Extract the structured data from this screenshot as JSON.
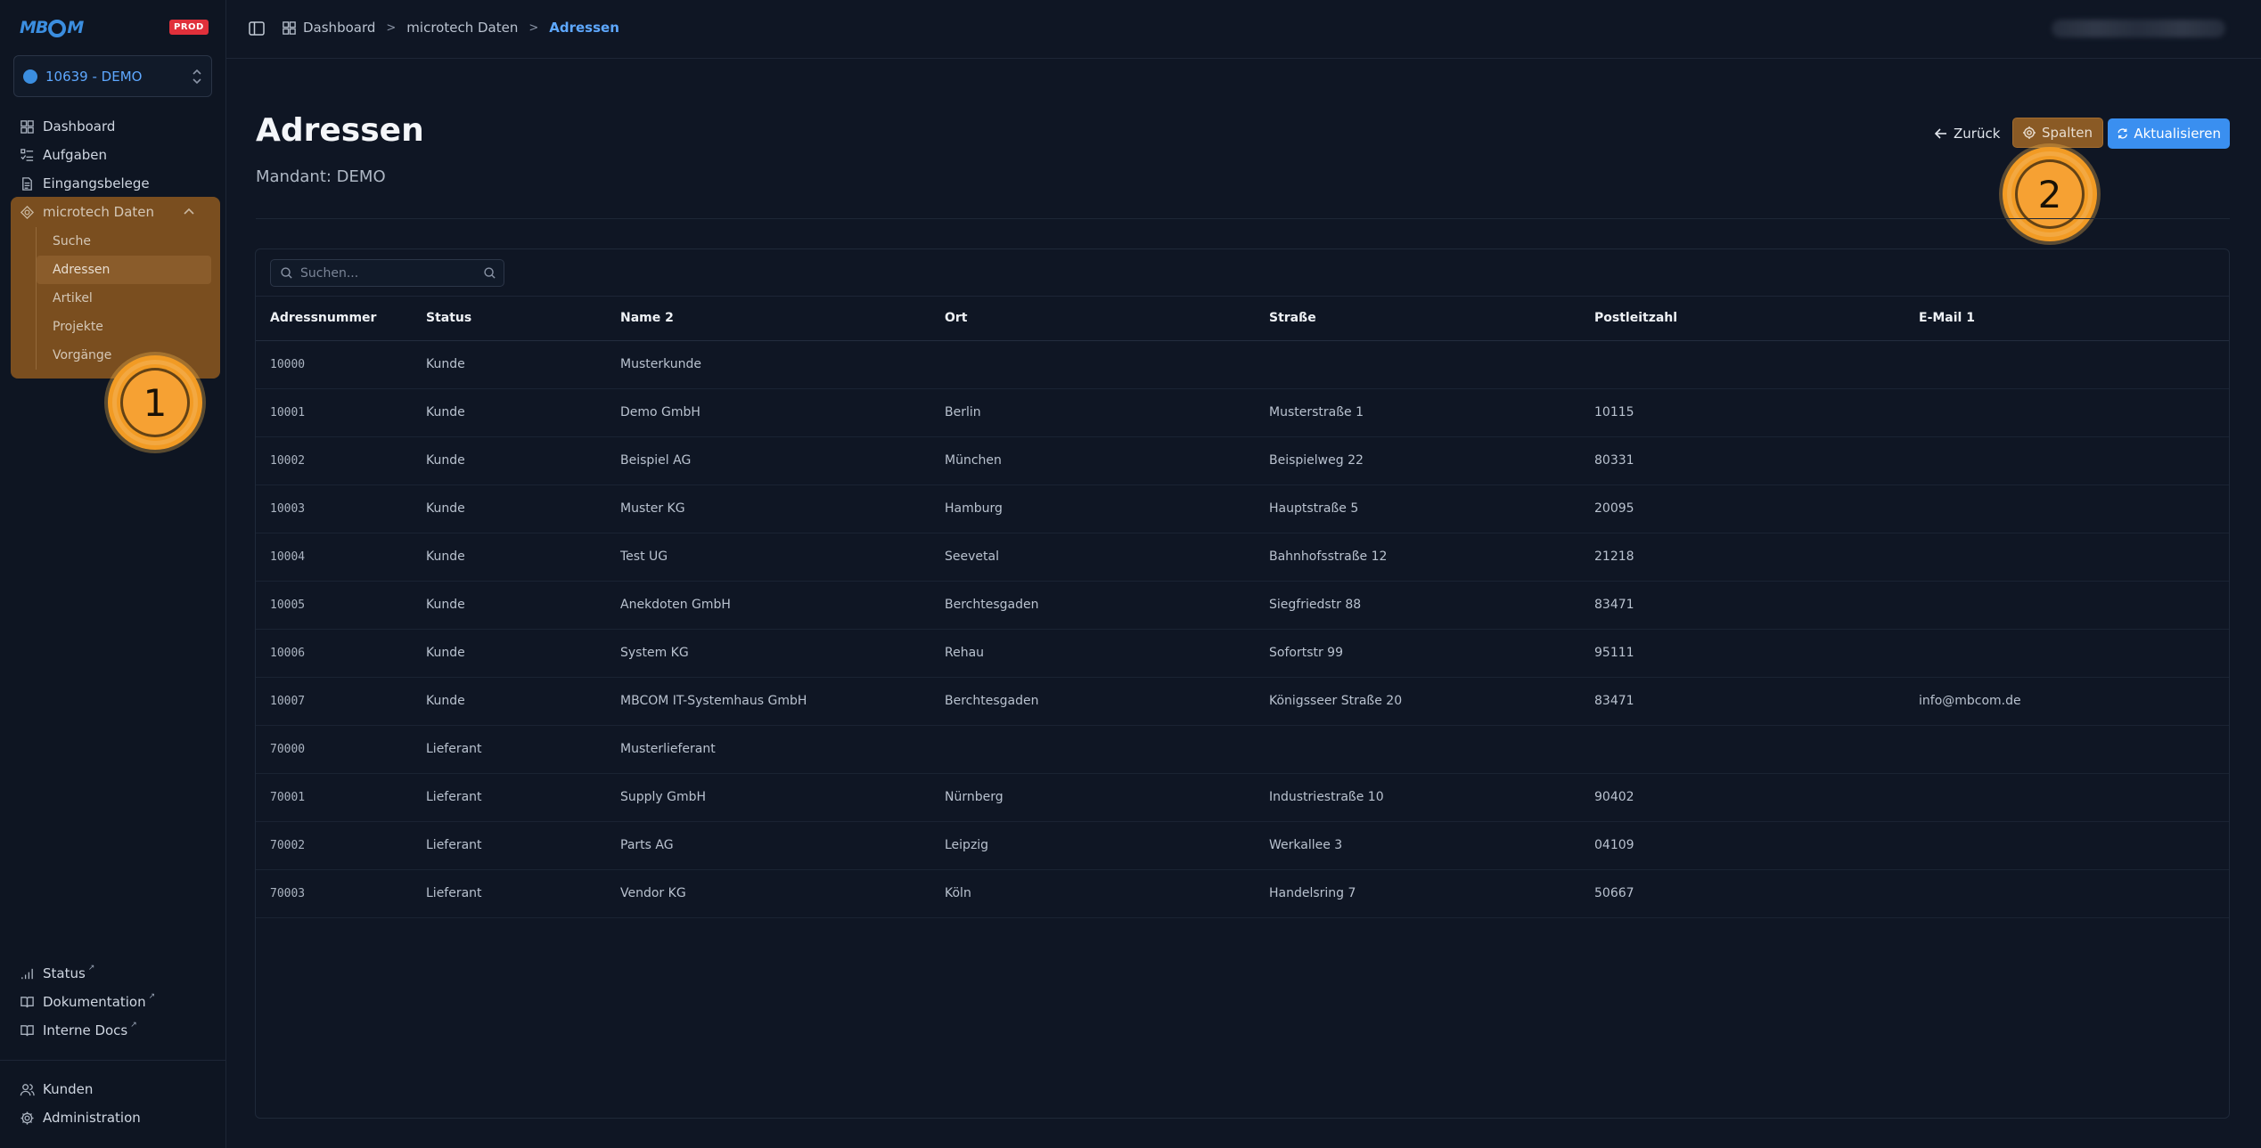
{
  "brand": {
    "logo_text_left": "MB",
    "logo_text_right": "M",
    "env_badge": "PROD"
  },
  "tenant": {
    "label": "10639 - DEMO"
  },
  "sidebar": {
    "items": [
      {
        "label": "Dashboard",
        "icon": "dashboard-icon"
      },
      {
        "label": "Aufgaben",
        "icon": "tasks-icon"
      },
      {
        "label": "Eingangsbelege",
        "icon": "document-icon"
      }
    ],
    "group": {
      "label": "microtech Daten",
      "icon": "database-icon",
      "children": [
        "Suche",
        "Adressen",
        "Artikel",
        "Projekte",
        "Vorgänge"
      ],
      "active_child": "Adressen"
    },
    "links": [
      {
        "label": "Status",
        "icon": "signal-icon"
      },
      {
        "label": "Dokumentation",
        "icon": "book-icon"
      },
      {
        "label": "Interne Docs",
        "icon": "book-icon"
      }
    ],
    "bottom": [
      {
        "label": "Kunden",
        "icon": "users-icon"
      },
      {
        "label": "Administration",
        "icon": "gear-icon"
      }
    ]
  },
  "breadcrumb": [
    "Dashboard",
    "microtech Daten",
    "Adressen"
  ],
  "page": {
    "title": "Adressen",
    "subtitle": "Mandant: DEMO"
  },
  "actions": {
    "back": "Zurück",
    "columns": "Spalten",
    "refresh": "Aktualisieren"
  },
  "search": {
    "placeholder": "Suchen..."
  },
  "annotations": {
    "marker1": "1",
    "marker2": "2",
    "color": "#f29b24"
  },
  "table": {
    "columns": [
      "Adressnummer",
      "Status",
      "Name 2",
      "Ort",
      "Straße",
      "Postleitzahl",
      "E-Mail 1"
    ],
    "rows": [
      [
        "10000",
        "Kunde",
        "Musterkunde",
        "",
        "",
        "",
        ""
      ],
      [
        "10001",
        "Kunde",
        "Demo GmbH",
        "Berlin",
        "Musterstraße 1",
        "10115",
        ""
      ],
      [
        "10002",
        "Kunde",
        "Beispiel AG",
        "München",
        "Beispielweg 22",
        "80331",
        ""
      ],
      [
        "10003",
        "Kunde",
        "Muster KG",
        "Hamburg",
        "Hauptstraße 5",
        "20095",
        ""
      ],
      [
        "10004",
        "Kunde",
        "Test UG",
        "Seevetal",
        "Bahnhofsstraße 12",
        "21218",
        ""
      ],
      [
        "10005",
        "Kunde",
        "Anekdoten GmbH",
        "Berchtesgaden",
        "Siegfriedstr 88",
        "83471",
        ""
      ],
      [
        "10006",
        "Kunde",
        "System KG",
        "Rehau",
        "Sofortstr 99",
        "95111",
        ""
      ],
      [
        "10007",
        "Kunde",
        "MBCOM IT-Systemhaus GmbH",
        "Berchtesgaden",
        "Königsseer Straße 20",
        "83471",
        "info@mbcom.de"
      ],
      [
        "70000",
        "Lieferant",
        "Musterlieferant",
        "",
        "",
        "",
        ""
      ],
      [
        "70001",
        "Lieferant",
        "Supply GmbH",
        "Nürnberg",
        "Industriestraße 10",
        "90402",
        ""
      ],
      [
        "70002",
        "Lieferant",
        "Parts AG",
        "Leipzig",
        "Werkallee 3",
        "04109",
        ""
      ],
      [
        "70003",
        "Lieferant",
        "Vendor KG",
        "Köln",
        "Handelsring 7",
        "50667",
        ""
      ]
    ]
  }
}
